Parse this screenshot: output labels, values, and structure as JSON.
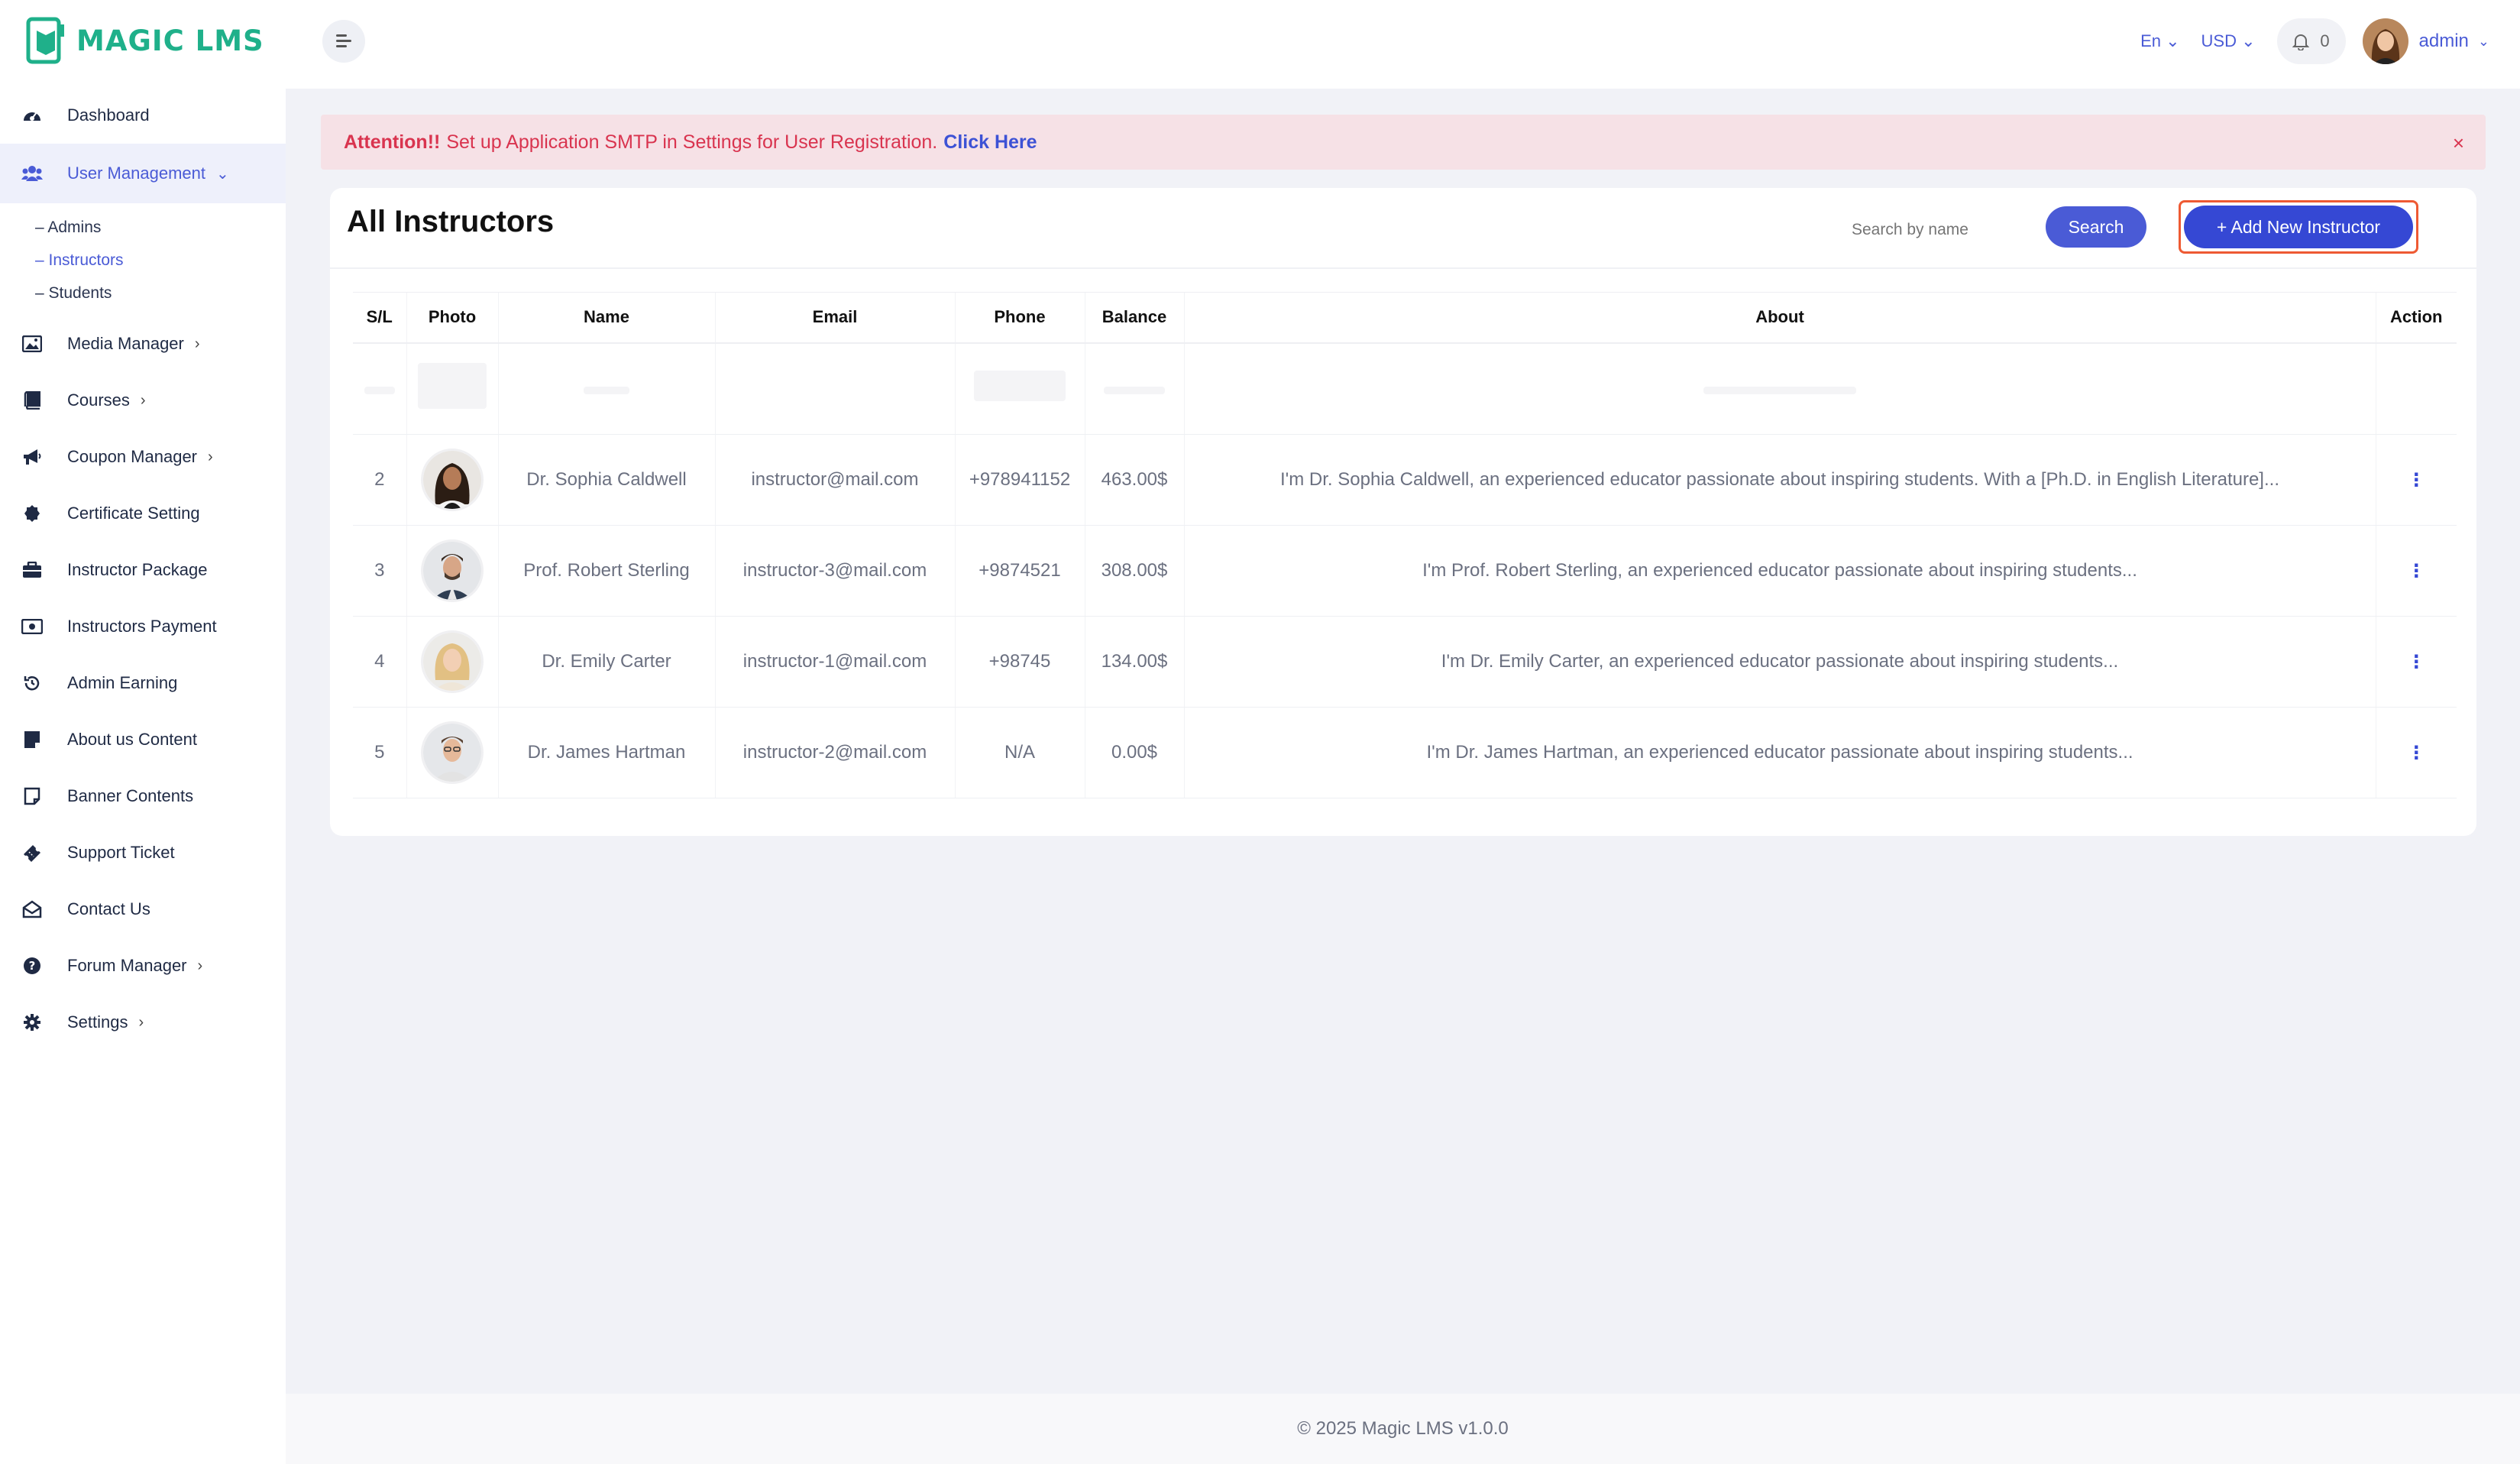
{
  "app": {
    "logo_text": "MAGIC LMS",
    "brand_color": "#1fb08a",
    "accent_color": "#4a5bd6"
  },
  "sidebar": {
    "items": [
      {
        "label": "Dashboard",
        "icon": "dashboard-icon"
      },
      {
        "label": "User Management",
        "icon": "users-icon",
        "active": true
      },
      {
        "label": "Media Manager",
        "icon": "image-icon"
      },
      {
        "label": "Courses",
        "icon": "book-icon"
      },
      {
        "label": "Coupon Manager",
        "icon": "megaphone-icon"
      },
      {
        "label": "Certificate Setting",
        "icon": "badge-icon"
      },
      {
        "label": "Instructor Package",
        "icon": "briefcase-icon"
      },
      {
        "label": "Instructors Payment",
        "icon": "money-icon"
      },
      {
        "label": "Admin Earning",
        "icon": "history-icon"
      },
      {
        "label": "About us Content",
        "icon": "note-icon"
      },
      {
        "label": "Banner Contents",
        "icon": "page-icon"
      },
      {
        "label": "Support Ticket",
        "icon": "ticket-icon"
      },
      {
        "label": "Contact Us",
        "icon": "mail-open-icon"
      },
      {
        "label": "Forum Manager",
        "icon": "question-icon"
      },
      {
        "label": "Settings",
        "icon": "gear-icon"
      }
    ],
    "sub_items": [
      {
        "label": "– Admins"
      },
      {
        "label": "– Instructors",
        "current": true
      },
      {
        "label": "– Students"
      }
    ]
  },
  "topbar": {
    "language": "En",
    "currency": "USD",
    "notification_count": "0",
    "user_name": "admin"
  },
  "alert": {
    "attention": "Attention!!",
    "message": "Set up Application SMTP in Settings for User Registration.",
    "link": "Click Here",
    "close": "×"
  },
  "card": {
    "title": "All Instructors",
    "search_placeholder": "Search by name",
    "search_button": "Search",
    "add_button": "+ Add New Instructor"
  },
  "table": {
    "headers": [
      "S/L",
      "Photo",
      "Name",
      "Email",
      "Phone",
      "Balance",
      "About",
      "Action"
    ],
    "rows": [
      {
        "sl": "2",
        "name": "Dr. Sophia Caldwell",
        "email": "instructor@mail.com",
        "phone": "+978941152",
        "balance": "463.00$",
        "about": "I'm Dr. Sophia Caldwell, an experienced educator passionate about inspiring students. With a [Ph.D. in English Literature]...",
        "action": "⋮"
      },
      {
        "sl": "3",
        "name": "Prof. Robert Sterling",
        "email": "instructor-3@mail.com",
        "phone": "+9874521",
        "balance": "308.00$",
        "about": "I'm Prof. Robert Sterling, an experienced educator passionate about inspiring students...",
        "action": "⋮"
      },
      {
        "sl": "4",
        "name": "Dr. Emily Carter",
        "email": "instructor-1@mail.com",
        "phone": "+98745",
        "balance": "134.00$",
        "about": "I'm Dr. Emily Carter, an experienced educator passionate about inspiring students...",
        "action": "⋮"
      },
      {
        "sl": "5",
        "name": "Dr. James Hartman",
        "email": "instructor-2@mail.com",
        "phone": "N/A",
        "balance": "0.00$",
        "about": "I'm Dr. James Hartman, an experienced educator passionate about inspiring students...",
        "action": "⋮"
      }
    ]
  },
  "footer": {
    "text": "© 2025 Magic LMS v1.0.0"
  }
}
